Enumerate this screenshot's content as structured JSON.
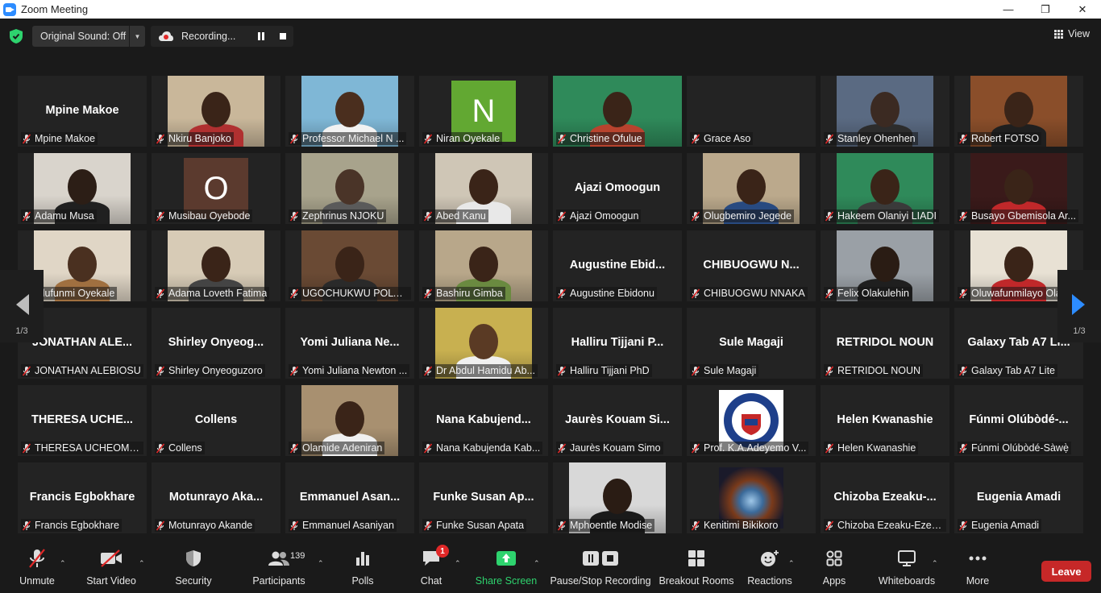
{
  "window": {
    "title": "Zoom Meeting"
  },
  "topbar": {
    "sound_label": "Original Sound: Off",
    "recording_label": "Recording...",
    "view_label": "View"
  },
  "pager": {
    "left_label": "1/3",
    "right_label": "1/3"
  },
  "tiles": [
    {
      "name": "Mpine Makoe",
      "center": "Mpine Makoe",
      "kind": "name"
    },
    {
      "name": "Nkiru Banjoko",
      "kind": "video",
      "bg": "#c9b79a",
      "skin": "#3a2418",
      "shirt": "#b03030"
    },
    {
      "name": "Professor Michael N ...",
      "kind": "video",
      "bg": "#7fb7d6",
      "skin": "#4a2e1e",
      "shirt": "#f2f2f2"
    },
    {
      "name": "Niran Oyekale",
      "kind": "letter",
      "letter": "N",
      "color": "#62a832"
    },
    {
      "name": "Christine Ofulue",
      "kind": "video",
      "bg": "#2f8a5a",
      "skin": "#3a2418",
      "shirt": "#b8432e",
      "active": true
    },
    {
      "name": "Grace Aso",
      "kind": "blank"
    },
    {
      "name": "Stanley Ohenhen",
      "kind": "video",
      "bg": "#5a6a82",
      "skin": "#3b2a22",
      "shirt": "#2c2c2c"
    },
    {
      "name": "Robert FOTSO",
      "kind": "video",
      "bg": "#8a4e2a",
      "skin": "#3a2418",
      "shirt": "#1f1f1f"
    },
    {
      "name": "Adamu Musa",
      "kind": "video",
      "bg": "#d9d4cc",
      "skin": "#2c1e16",
      "shirt": "#202020"
    },
    {
      "name": "Musibau Oyebode",
      "kind": "letter",
      "letter": "O",
      "color": "#5b3a2e"
    },
    {
      "name": "Zephrinus NJOKU",
      "kind": "video",
      "bg": "#a8a38c",
      "skin": "#4a3428",
      "shirt": "#5a5a5a"
    },
    {
      "name": "Abed Kanu",
      "kind": "video",
      "bg": "#cfc6b6",
      "skin": "#3a2418",
      "shirt": "#e8e8e8"
    },
    {
      "name": "Ajazi Omoogun",
      "center": "Ajazi Omoogun",
      "kind": "name"
    },
    {
      "name": "Olugbemiro Jegede",
      "kind": "video",
      "bg": "#bba98c",
      "skin": "#3a2418",
      "shirt": "#284a80"
    },
    {
      "name": "Hakeem Olaniyi LIADI",
      "kind": "video",
      "bg": "#2f8a5a",
      "skin": "#3a2418",
      "shirt": "#3a3a3a"
    },
    {
      "name": "Busayo Gbemisola Ar...",
      "kind": "video",
      "bg": "#3a1a1a",
      "skin": "#3a2418",
      "shirt": "#c0282a"
    },
    {
      "name": "Olufunmi Oyekale",
      "kind": "video",
      "bg": "#e0d6c6",
      "skin": "#4a3020",
      "shirt": "#a07040"
    },
    {
      "name": "Adama Loveth Fatima",
      "kind": "video",
      "bg": "#d7cbb6",
      "skin": "#3a2418",
      "shirt": "#444"
    },
    {
      "name": "UGOCHUKWU POLY NG...",
      "kind": "video",
      "bg": "#6a4a34",
      "skin": "#3a2418",
      "shirt": "#2a2a2a"
    },
    {
      "name": "Bashiru Gimba",
      "kind": "video",
      "bg": "#b8a78a",
      "skin": "#3a2418",
      "shirt": "#6a8a40"
    },
    {
      "name": "Augustine Ebidonu",
      "center": "Augustine Ebid...",
      "kind": "name"
    },
    {
      "name": "CHIBUOGWU NNAKA",
      "center": "CHIBUOGWU N...",
      "kind": "name"
    },
    {
      "name": "Felix Olakulehin",
      "kind": "video",
      "bg": "#9aa0a6",
      "skin": "#2a1c14",
      "shirt": "#1f1f1f"
    },
    {
      "name": "Oluwafunmilayo Olal",
      "kind": "video",
      "bg": "#e8e1d4",
      "skin": "#3a2418",
      "shirt": "#c0282a"
    },
    {
      "name": "JONATHAN ALEBIOSU",
      "center": "JONATHAN ALE...",
      "kind": "name"
    },
    {
      "name": "Shirley Onyeoguzoro",
      "center": "Shirley Onyeog...",
      "kind": "name"
    },
    {
      "name": "Yomi Juliana Newton ...",
      "center": "Yomi Juliana Ne...",
      "kind": "name"
    },
    {
      "name": "Dr Abdul Hamidu Ab...",
      "kind": "video",
      "bg": "#c8b050",
      "skin": "#5a3a24",
      "shirt": "#f0f0f0"
    },
    {
      "name": "Halliru Tijjani  PhD",
      "center": "Halliru Tijjani  P...",
      "kind": "name"
    },
    {
      "name": "Sule Magaji",
      "center": "Sule Magaji",
      "kind": "name"
    },
    {
      "name": "RETRIDOL NOUN",
      "center": "RETRIDOL NOUN",
      "kind": "name"
    },
    {
      "name": "Galaxy Tab A7 Lite",
      "center": "Galaxy Tab A7 Li...",
      "kind": "name"
    },
    {
      "name": "THERESA UCHEOMA ...",
      "center": "THERESA  UCHE...",
      "kind": "name"
    },
    {
      "name": "Collens",
      "center": "Collens",
      "kind": "name"
    },
    {
      "name": "Olamide Adeniran",
      "kind": "video",
      "bg": "#a89070",
      "skin": "#3a2418",
      "shirt": "#f0f0f0"
    },
    {
      "name": "Nana Kabujenda Kab...",
      "center": "Nana  Kabujend...",
      "kind": "name"
    },
    {
      "name": "Jaurès Kouam Simo",
      "center": "Jaurès Kouam Si...",
      "kind": "name"
    },
    {
      "name": "Prof. K.A.Adeyemo V...",
      "kind": "logo"
    },
    {
      "name": "Helen Kwanashie",
      "center": "Helen Kwanashie",
      "kind": "name"
    },
    {
      "name": "Fúnmi Olúbòdé-Sàwẹ̀",
      "center": "Fúnmi  Olúbòdé-...",
      "kind": "name"
    },
    {
      "name": "Francis Egbokhare",
      "center": "Francis Egbokhare",
      "kind": "name"
    },
    {
      "name": "Motunrayo Akande",
      "center": "Motunrayo  Aka...",
      "kind": "name"
    },
    {
      "name": "Emmanuel Asaniyan",
      "center": "Emmanuel  Asan...",
      "kind": "name"
    },
    {
      "name": "Funke Susan Apata",
      "center": "Funke Susan Ap...",
      "kind": "name"
    },
    {
      "name": "Mphoentle Modise",
      "kind": "video",
      "bg": "#d8d8d8",
      "skin": "#2a1c14",
      "shirt": "#1a1a1a"
    },
    {
      "name": "Kenitimi Bikikoro",
      "kind": "galaxy"
    },
    {
      "name": "Chizoba Ezeaku-Ezeme",
      "center": "Chizoba  Ezeaku-...",
      "kind": "name"
    },
    {
      "name": "Eugenia Amadi",
      "center": "Eugenia Amadi",
      "kind": "name"
    }
  ],
  "toolbar": {
    "unmute": "Unmute",
    "start_video": "Start Video",
    "security": "Security",
    "participants": "Participants",
    "participants_count": "139",
    "polls": "Polls",
    "chat": "Chat",
    "chat_badge": "1",
    "share_screen": "Share Screen",
    "pause_stop_recording": "Pause/Stop Recording",
    "breakout_rooms": "Breakout Rooms",
    "reactions": "Reactions",
    "apps": "Apps",
    "whiteboards": "Whiteboards",
    "more": "More",
    "leave": "Leave"
  },
  "colors": {
    "accent_green": "#2ed36e",
    "leave_red": "#c62828",
    "active_speaker": "#e6e63a",
    "pager_blue": "#2d8cff"
  }
}
